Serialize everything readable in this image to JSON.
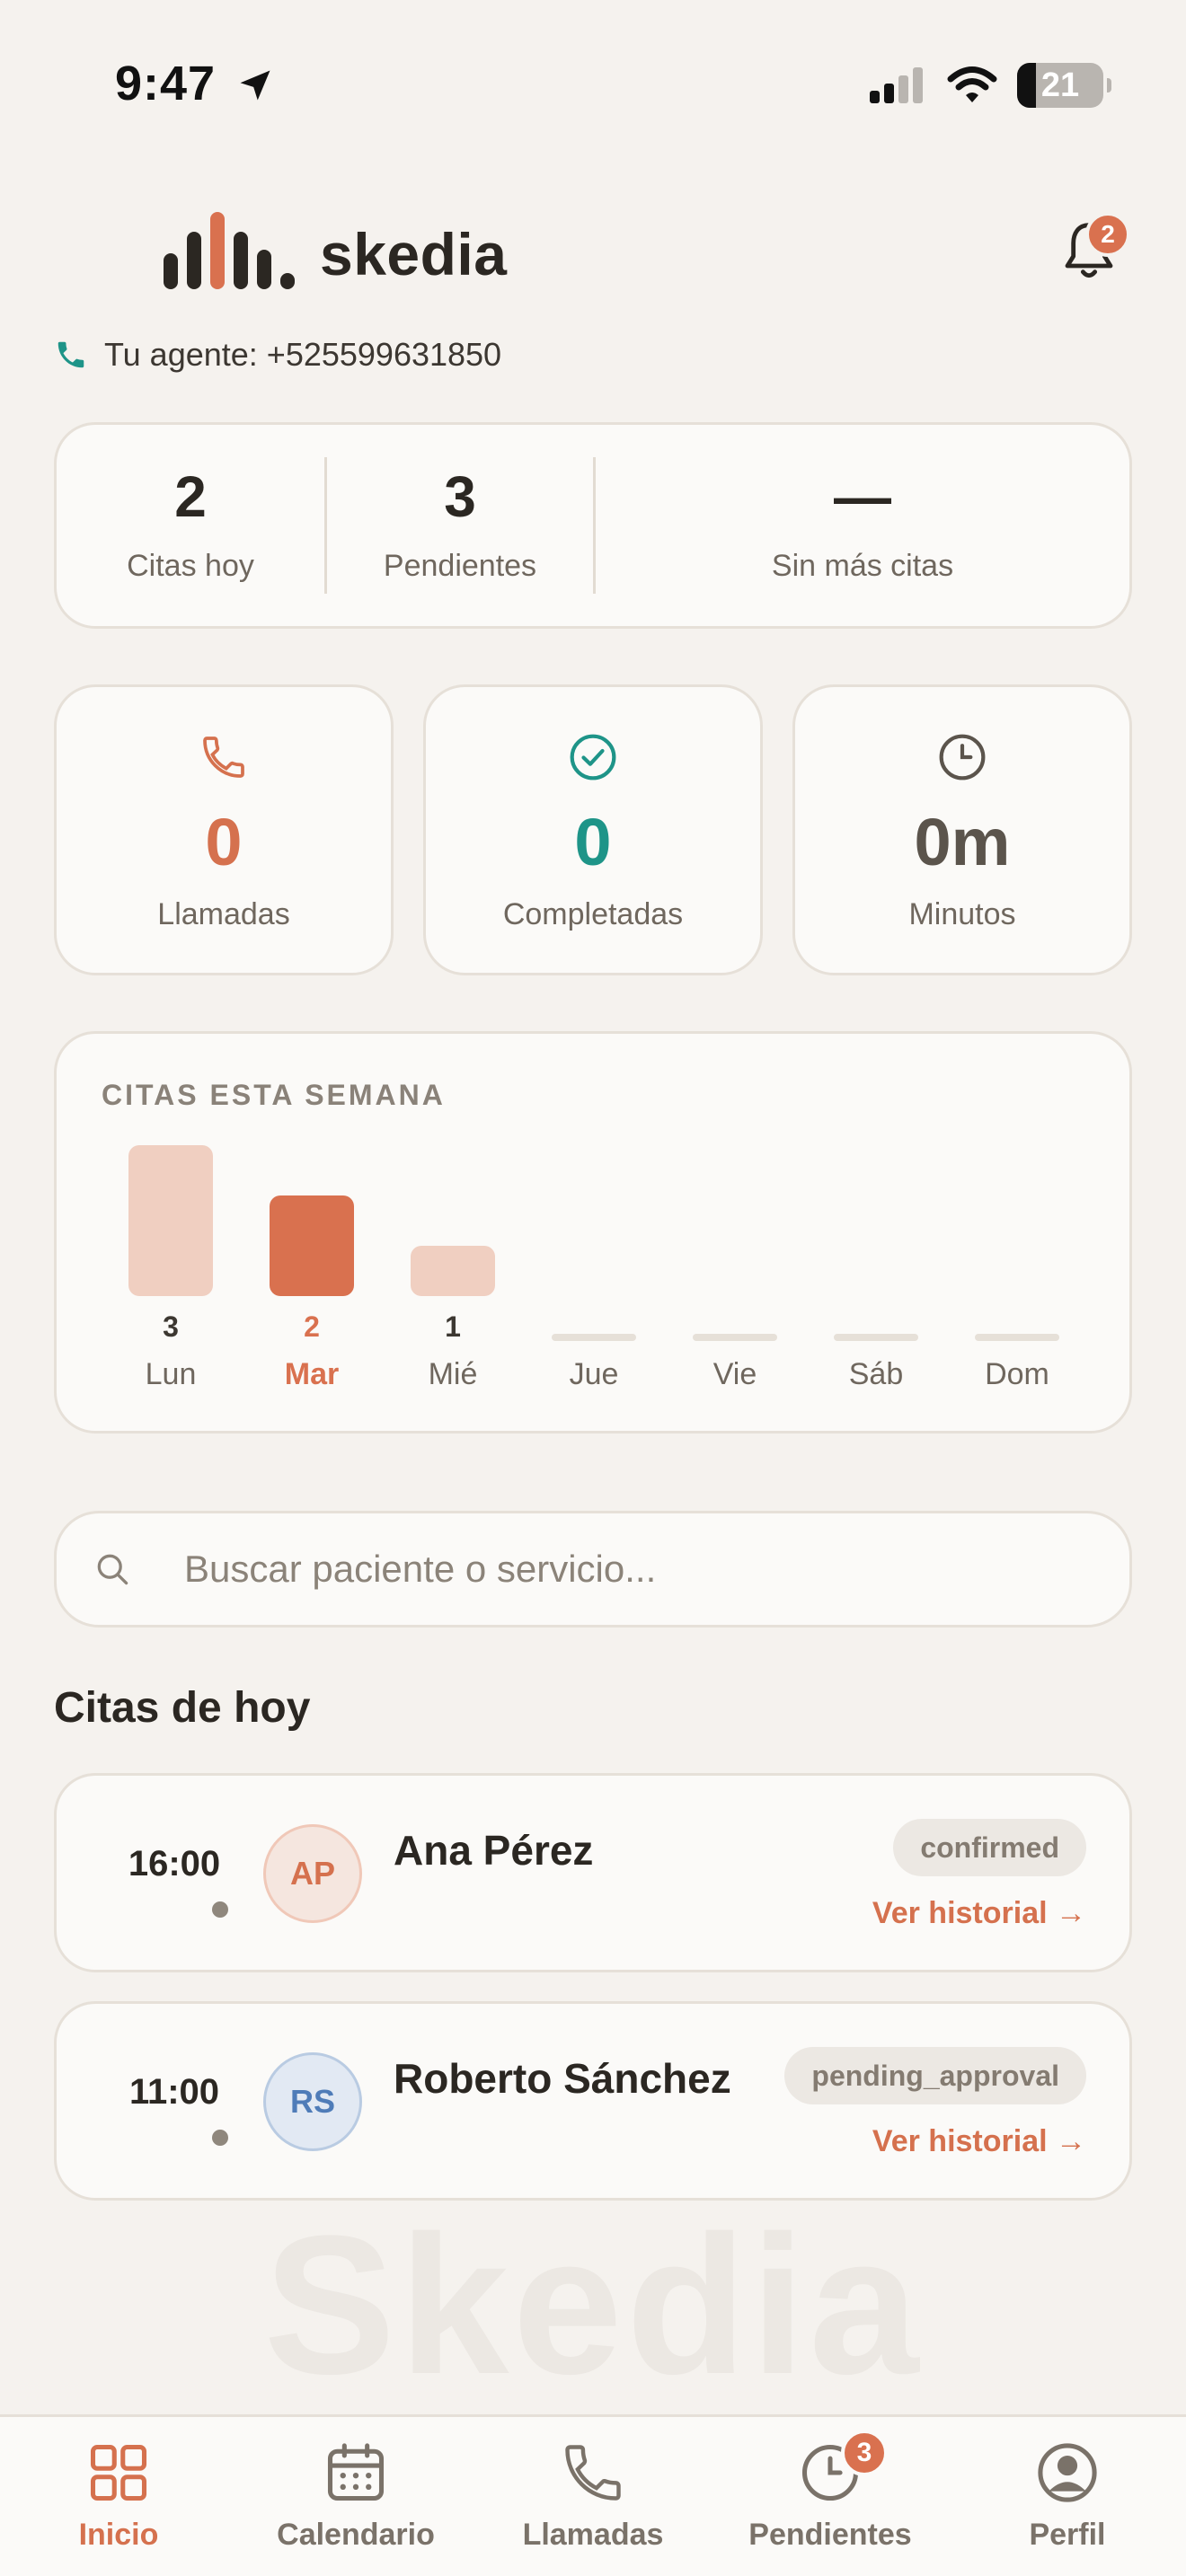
{
  "status_bar": {
    "time": "9:47",
    "battery": "21"
  },
  "header": {
    "logo_text": "skedia",
    "notification_count": "2"
  },
  "agent": {
    "text": "Tu agente: +525599631850"
  },
  "summary": [
    {
      "value": "2",
      "label": "Citas hoy"
    },
    {
      "value": "3",
      "label": "Pendientes"
    },
    {
      "value": "—",
      "label": "Sin más citas"
    }
  ],
  "stats": [
    {
      "icon": "phone-icon",
      "value": "0",
      "label": "Llamadas",
      "color": "#d5714e"
    },
    {
      "icon": "check-circle-icon",
      "value": "0",
      "label": "Completadas",
      "color": "#1e9488"
    },
    {
      "icon": "clock-icon",
      "value": "0m",
      "label": "Minutos",
      "color": "#5b544c"
    }
  ],
  "chart_data": {
    "type": "bar",
    "title": "CITAS ESTA SEMANA",
    "categories": [
      "Lun",
      "Mar",
      "Mié",
      "Jue",
      "Vie",
      "Sáb",
      "Dom"
    ],
    "values": [
      3,
      2,
      1,
      0,
      0,
      0,
      0
    ],
    "highlight_index": 1,
    "colors": {
      "bar": "#f0cfc1",
      "highlight": "#d9714f",
      "empty": "#e6e0d8"
    }
  },
  "search": {
    "placeholder": "Buscar paciente o servicio..."
  },
  "appointments_title": "Citas de hoy",
  "appointments": [
    {
      "time": "16:00",
      "initials": "AP",
      "name": "Ana Pérez",
      "status": "confirmed",
      "link": "Ver historial →",
      "avatar_bg": "#f5e6df",
      "avatar_border": "#f0c8b8",
      "avatar_color": "#d5714e"
    },
    {
      "time": "11:00",
      "initials": "RS",
      "name": "Roberto Sánchez",
      "status": "pending_approval",
      "link": "Ver historial →",
      "avatar_bg": "#e2e9f3",
      "avatar_border": "#b9cbe2",
      "avatar_color": "#4f7cb8"
    }
  ],
  "watermark": "Skedia",
  "nav": [
    {
      "icon": "grid-icon",
      "label": "Inicio",
      "active": true
    },
    {
      "icon": "calendar-icon",
      "label": "Calendario"
    },
    {
      "icon": "phone-icon",
      "label": "Llamadas"
    },
    {
      "icon": "clock-icon",
      "label": "Pendientes",
      "badge": "3"
    },
    {
      "icon": "profile-icon",
      "label": "Perfil"
    }
  ]
}
